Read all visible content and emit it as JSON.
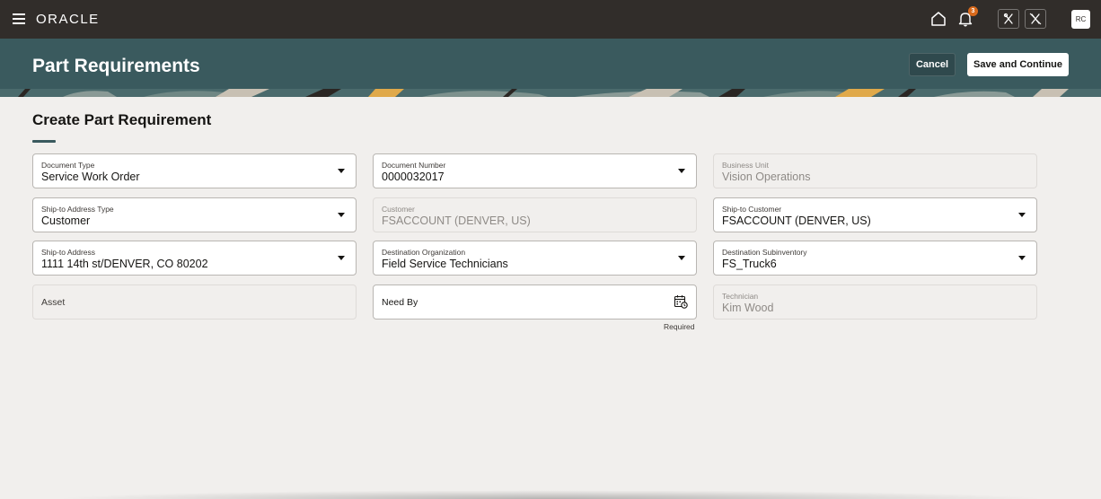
{
  "topbar": {
    "brand": "ORACLE",
    "notification_count": "3",
    "user_initials": "RC"
  },
  "header": {
    "title": "Part Requirements",
    "cancel_label": "Cancel",
    "save_label": "Save and Continue"
  },
  "form": {
    "title": "Create Part Requirement",
    "required_note": "Required",
    "fields": {
      "document_type": {
        "label": "Document Type",
        "value": "Service Work Order"
      },
      "document_number": {
        "label": "Document Number",
        "value": "0000032017"
      },
      "business_unit": {
        "label": "Business Unit",
        "value": "Vision Operations"
      },
      "ship_to_address_type": {
        "label": "Ship-to Address Type",
        "value": "Customer"
      },
      "customer": {
        "label": "Customer",
        "value": "FSACCOUNT (DENVER, US)"
      },
      "ship_to_customer": {
        "label": "Ship-to Customer",
        "value": "FSACCOUNT (DENVER, US)"
      },
      "ship_to_address": {
        "label": "Ship-to Address",
        "value": "1111 14th st/DENVER, CO 80202"
      },
      "destination_organization": {
        "label": "Destination Organization",
        "value": "Field Service Technicians"
      },
      "destination_subinventory": {
        "label": "Destination Subinventory",
        "value": "FS_Truck6"
      },
      "asset": {
        "label": "Asset"
      },
      "need_by": {
        "label": "Need By"
      },
      "technician": {
        "label": "Technician",
        "value": "Kim Wood"
      }
    }
  },
  "colors": {
    "topbar": "#312d2a",
    "header": "#3a5a5e",
    "page_bg": "#f1efed",
    "badge": "#d96a1c"
  },
  "icons": [
    "hamburger-menu-icon",
    "home-icon",
    "bell-icon",
    "tools-icon",
    "tools-off-icon",
    "calendar-icon",
    "chevron-down-icon"
  ]
}
